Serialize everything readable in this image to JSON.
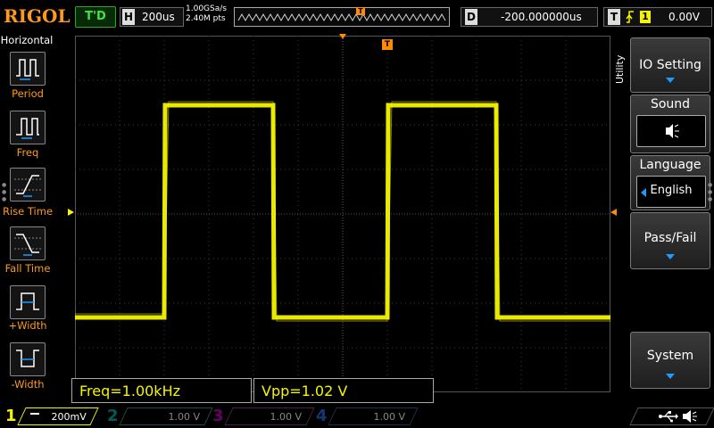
{
  "top": {
    "brand": "RIGOL",
    "status": "T'D",
    "timebase_letter": "H",
    "timebase_value": "200us",
    "sample_rate": "1.00GSa/s",
    "memory_depth": "2.40M pts",
    "delay_letter": "D",
    "delay_value": "-200.000000us",
    "trigger_letter": "T",
    "trigger_source": "1",
    "trigger_level": "0.00V",
    "trigger_marker": "T"
  },
  "left_menu": {
    "title": "Horizontal",
    "items": [
      {
        "label": "Period",
        "icon": "period-icon"
      },
      {
        "label": "Freq",
        "icon": "freq-icon"
      },
      {
        "label": "Rise Time",
        "icon": "rise-time-icon"
      },
      {
        "label": "Fall Time",
        "icon": "fall-time-icon"
      },
      {
        "label": "+Width",
        "icon": "positive-width-icon"
      },
      {
        "label": "-Width",
        "icon": "negative-width-icon"
      }
    ]
  },
  "right_menu": {
    "title": "Utility",
    "io_setting": "IO Setting",
    "sound": "Sound",
    "language": "Language",
    "language_value": "English",
    "pass_fail": "Pass/Fail",
    "system": "System"
  },
  "measurements": {
    "freq": "Freq=1.00kHz",
    "vpp": "Vpp=1.02 V"
  },
  "channels": [
    {
      "num": "1",
      "scale": "200mV",
      "color": "#f5f500",
      "active": true
    },
    {
      "num": "2",
      "scale": "1.00 V",
      "color": "#00c8c8",
      "active": false
    },
    {
      "num": "3",
      "scale": "1.00 V",
      "color": "#e000e0",
      "active": false
    },
    {
      "num": "4",
      "scale": "1.00 V",
      "color": "#2080ff",
      "active": false
    }
  ],
  "colors": {
    "trace": "#f5f500",
    "trigger_marker": "#ff8c00",
    "accent_blue": "#1e9bff",
    "status_green": "#3fe63f"
  }
}
